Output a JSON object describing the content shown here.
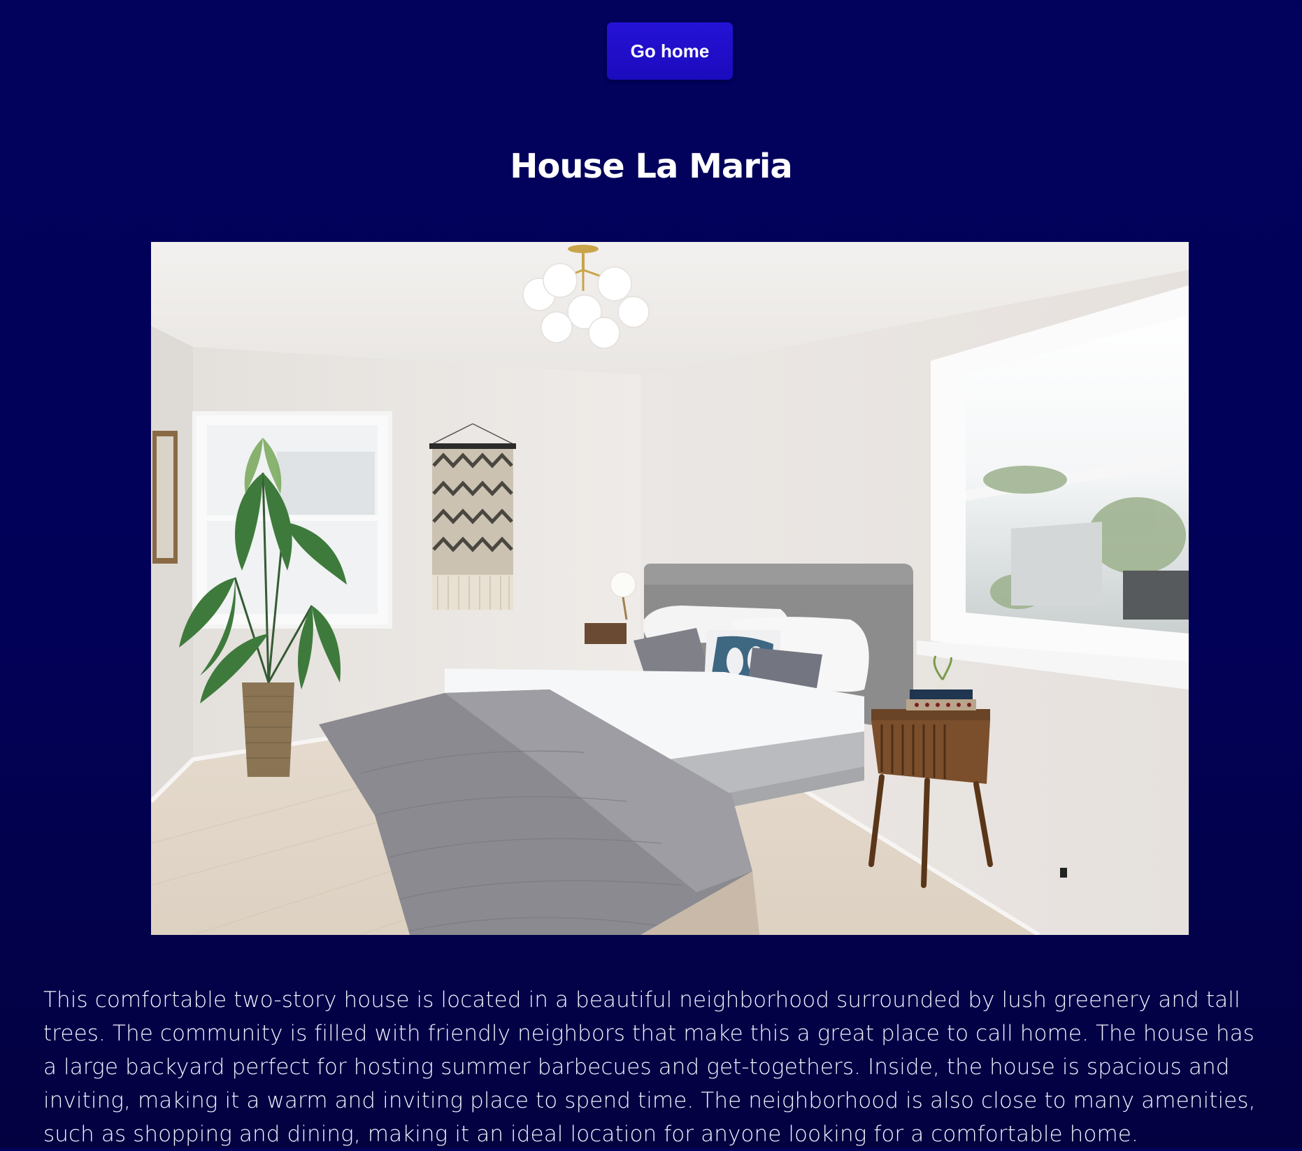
{
  "nav": {
    "go_home_label": "Go home"
  },
  "listing": {
    "title": "House La Maria",
    "image_alt": "Bright bedroom with grey upholstered bed, potted palm, woven wall hanging and window",
    "description": "This comfortable two-story house is located in a beautiful neighborhood surrounded by lush greenery and tall trees. The community is filled with friendly neighbors that make this a great place to call home. The house has a large backyard perfect for hosting summer barbecues and get-togethers. Inside, the house is spacious and inviting, making it a warm and inviting place to spend time. The neighborhood is also close to many amenities, such as shopping and dining, making it an ideal location for anyone looking for a comfortable home."
  },
  "colors": {
    "background": "#02015c",
    "button": "#2512d6",
    "text": "#ffffff"
  }
}
